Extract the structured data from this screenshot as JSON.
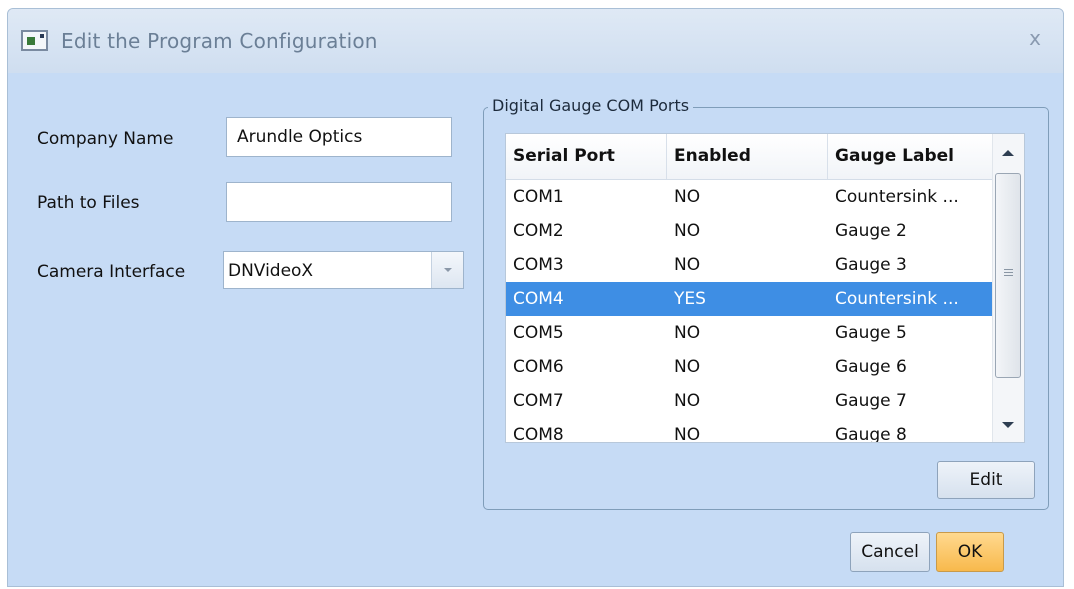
{
  "window": {
    "title": "Edit the Program Configuration",
    "close_glyph": "x"
  },
  "form": {
    "company_name_label": "Company Name",
    "company_name_value": "Arundle Optics",
    "path_label": "Path to Files",
    "path_value": "",
    "camera_label": "Camera Interface",
    "camera_value": "DNVideoX"
  },
  "gauges": {
    "group_title": "Digital Gauge COM Ports",
    "columns": [
      "Serial Port",
      "Enabled",
      "Gauge Label"
    ],
    "rows": [
      {
        "port": "COM1",
        "enabled": "NO",
        "label": "Countersink ...",
        "selected": false
      },
      {
        "port": "COM2",
        "enabled": "NO",
        "label": "Gauge 2",
        "selected": false
      },
      {
        "port": "COM3",
        "enabled": "NO",
        "label": "Gauge 3",
        "selected": false
      },
      {
        "port": "COM4",
        "enabled": "YES",
        "label": "Countersink ...",
        "selected": true
      },
      {
        "port": "COM5",
        "enabled": "NO",
        "label": "Gauge 5",
        "selected": false
      },
      {
        "port": "COM6",
        "enabled": "NO",
        "label": "Gauge 6",
        "selected": false
      },
      {
        "port": "COM7",
        "enabled": "NO",
        "label": "Gauge 7",
        "selected": false
      },
      {
        "port": "COM8",
        "enabled": "NO",
        "label": "Gauge 8",
        "selected": false
      }
    ],
    "edit_label": "Edit"
  },
  "actions": {
    "cancel_label": "Cancel",
    "ok_label": "OK"
  },
  "colors": {
    "client_bg": "#c6dbf5",
    "selected_row": "#3e8ee4",
    "ok_button": "#f8b94c"
  }
}
